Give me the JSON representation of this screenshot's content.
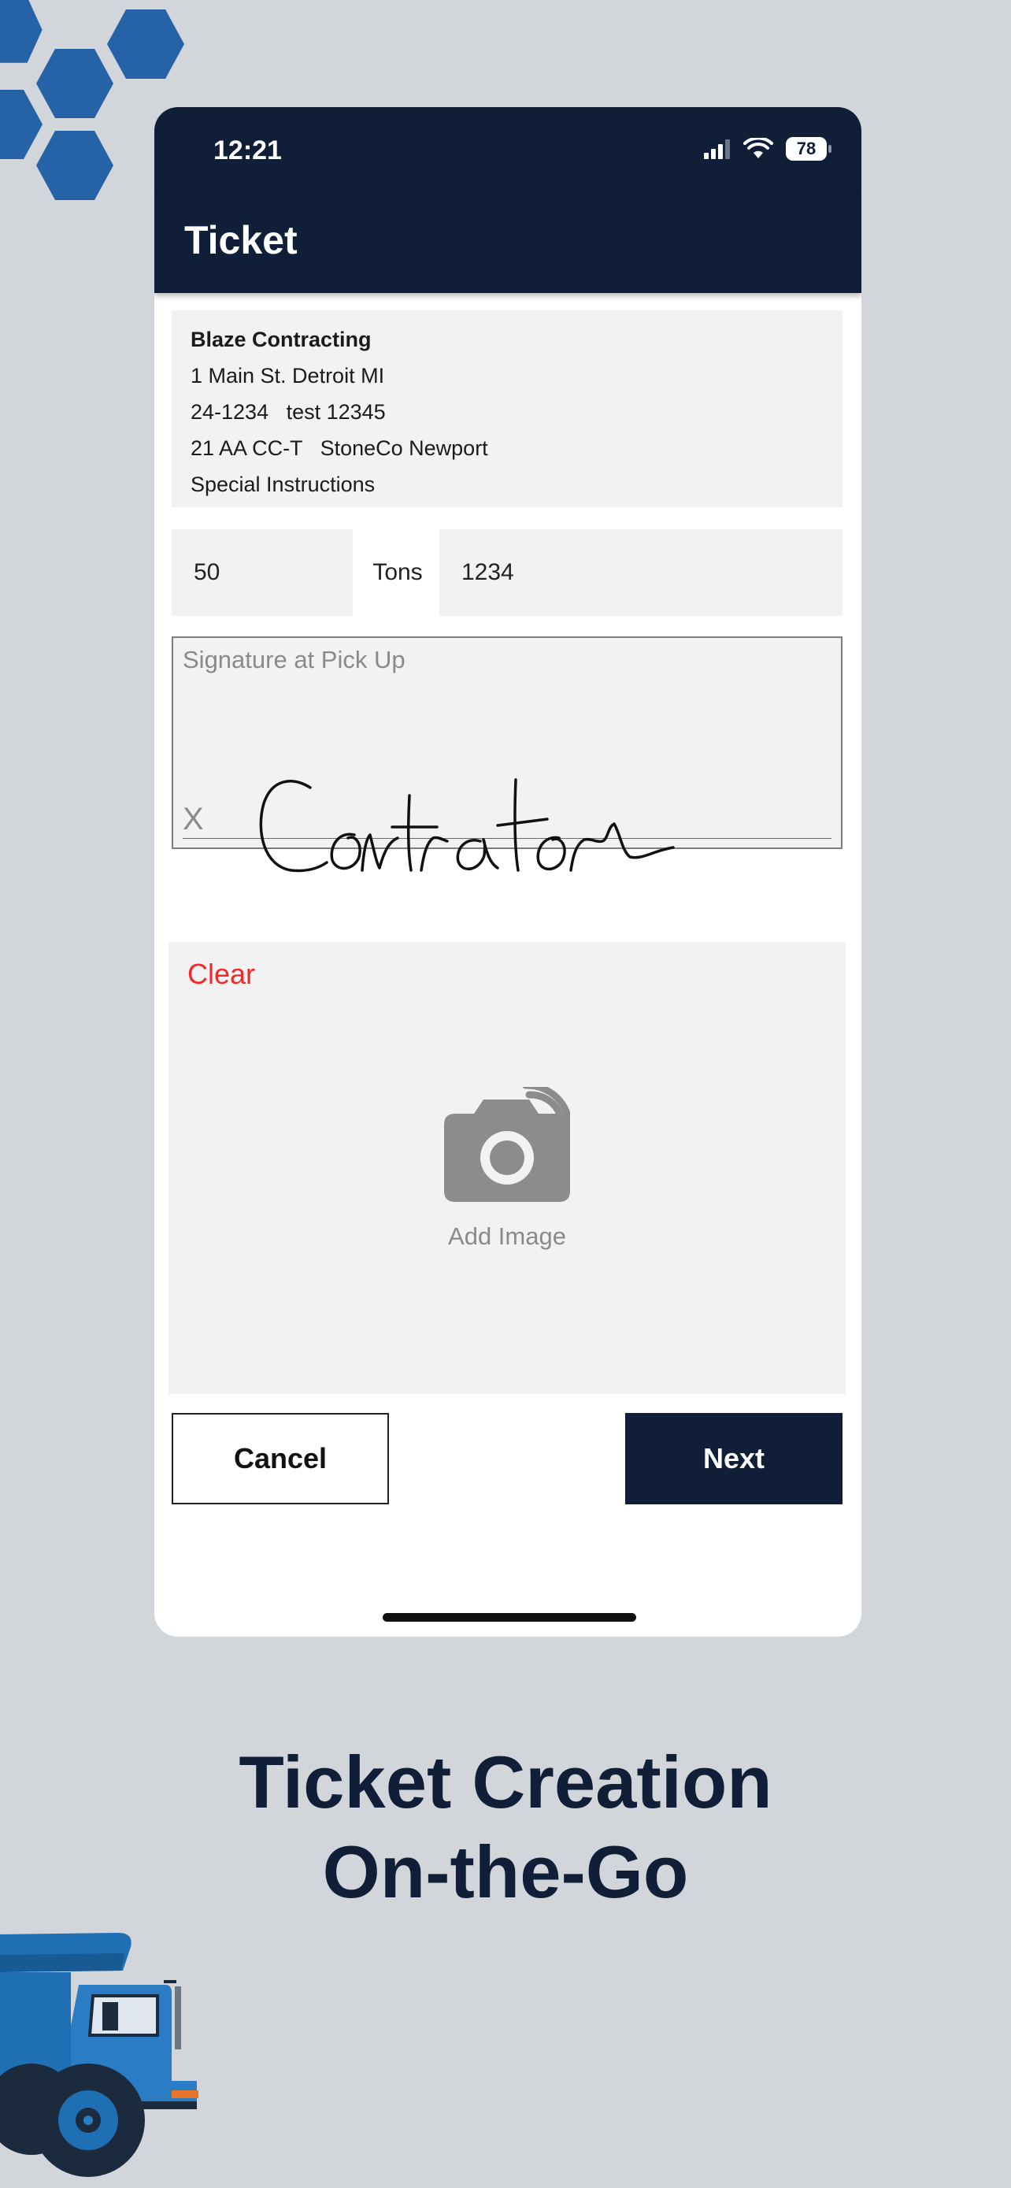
{
  "status_bar": {
    "time": "12:21",
    "battery": "78"
  },
  "app_bar": {
    "title": "Ticket"
  },
  "ticket_info": {
    "company": "Blaze Contracting",
    "address": "1 Main St. Detroit MI",
    "job_line": "24-1234   test 12345",
    "material_line": "21 AA CC-T   StoneCo Newport",
    "instructions": "Special Instructions"
  },
  "quantity": {
    "value": "50",
    "unit": "Tons"
  },
  "ticket_number": {
    "value": "1234"
  },
  "signature": {
    "label": "Signature at Pick Up",
    "x_mark": "X",
    "signed_text": "Contrator"
  },
  "image_section": {
    "clear_label": "Clear",
    "add_image_label": "Add Image"
  },
  "actions": {
    "cancel_label": "Cancel",
    "next_label": "Next"
  },
  "promo": {
    "headline_line1": "Ticket Creation",
    "headline_line2": "On-the-Go"
  },
  "colors": {
    "navy": "#101e38",
    "background": "#d2d5da",
    "clear_red": "#f02a2a",
    "hex_blue": "#1f5c9c"
  }
}
